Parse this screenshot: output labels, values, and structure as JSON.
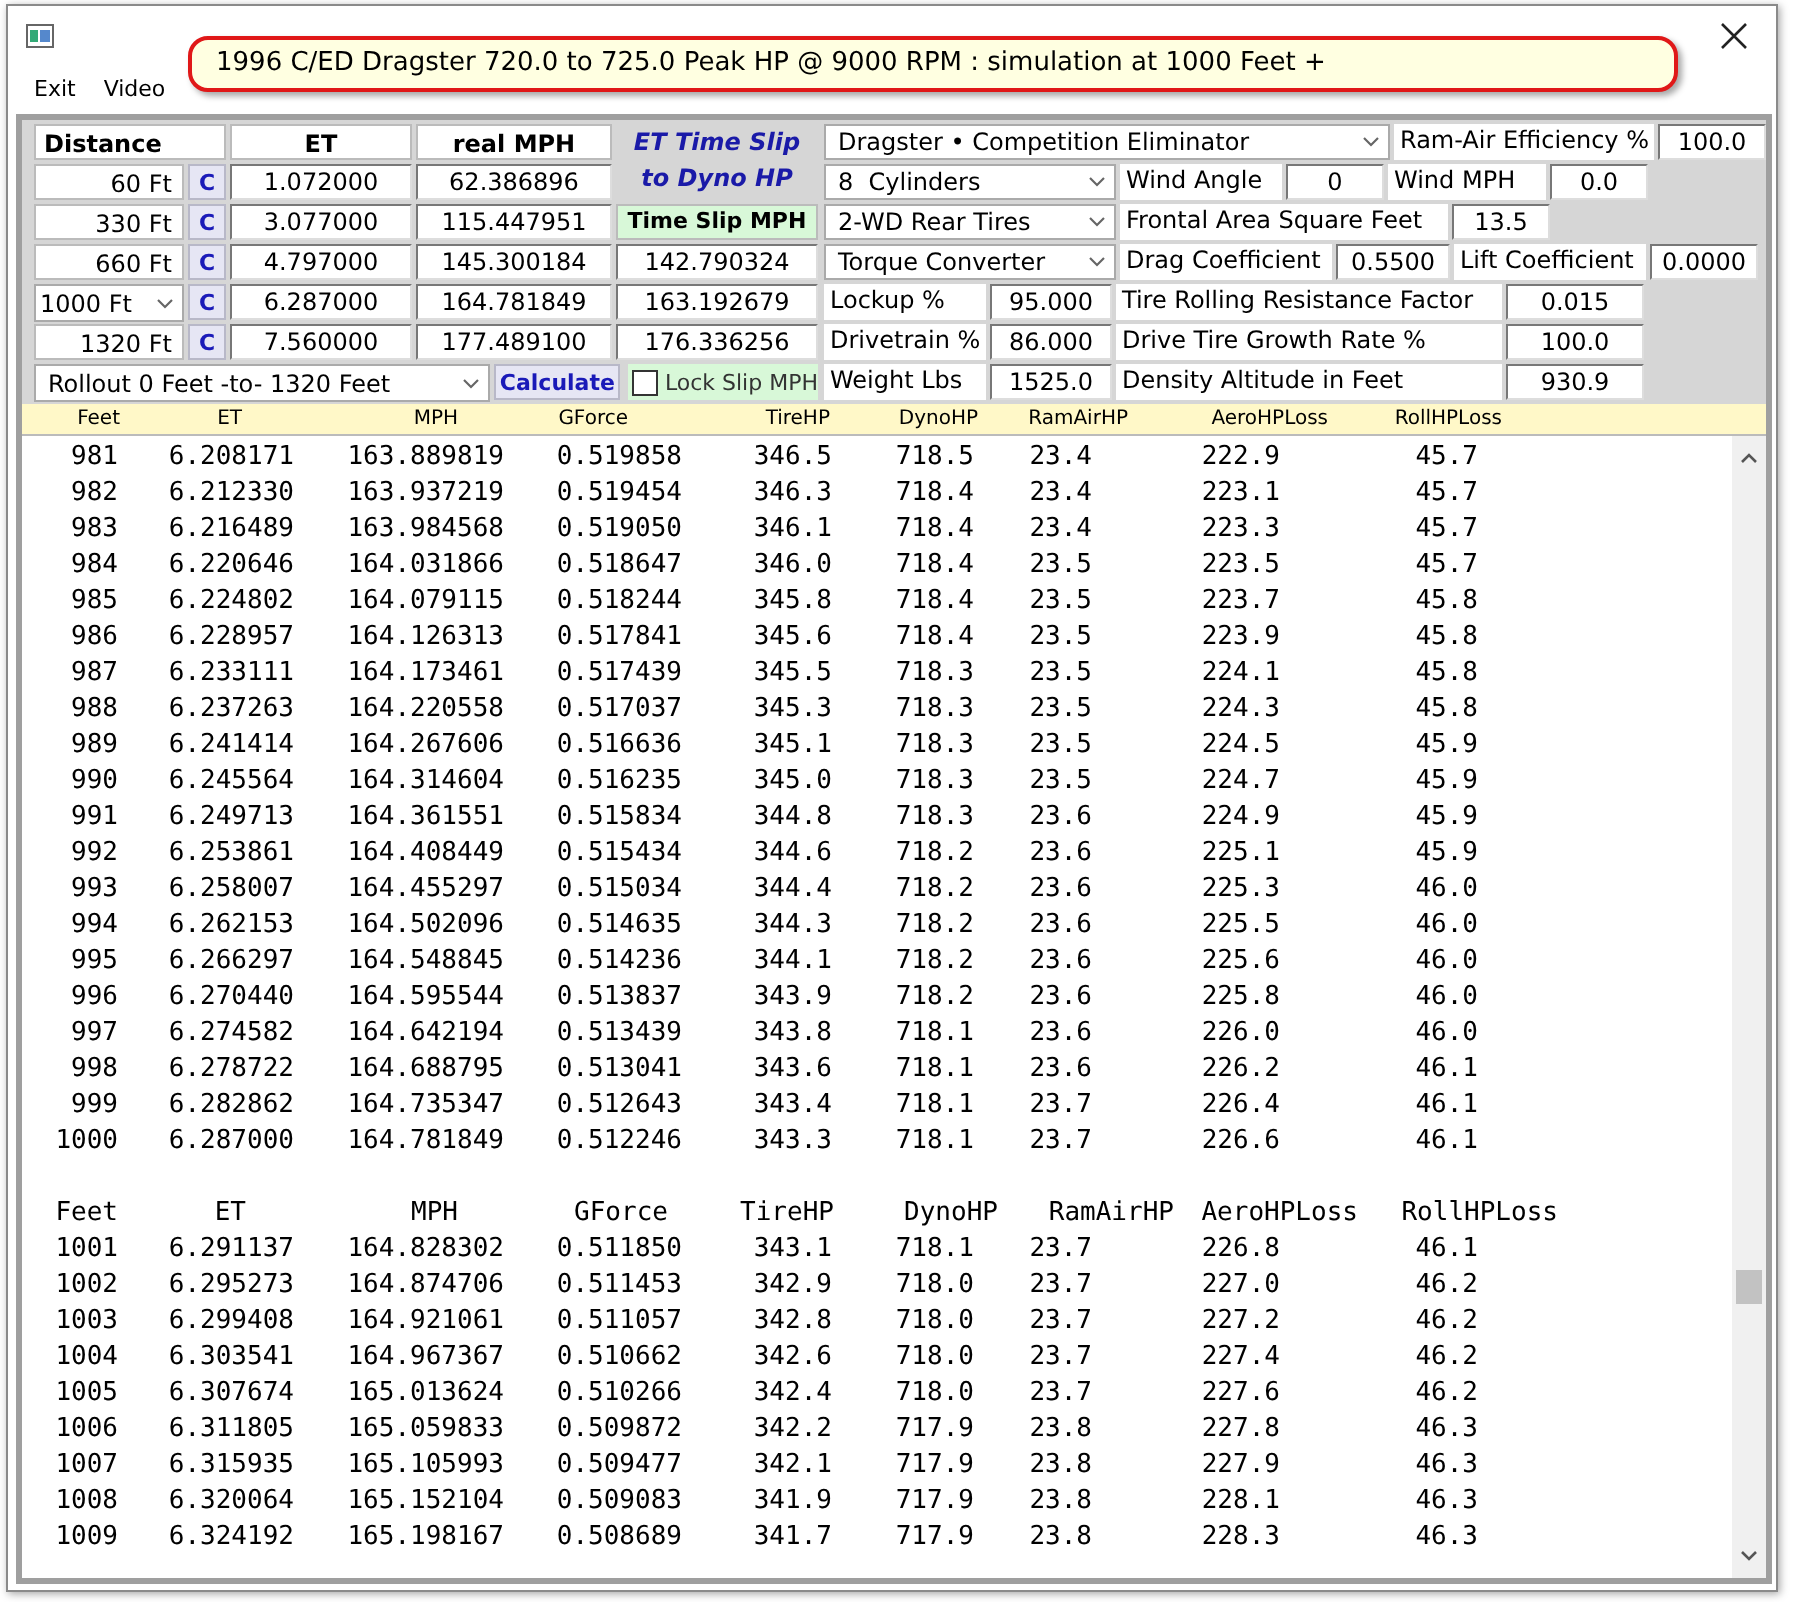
{
  "menu": [
    "Exit",
    "Video"
  ],
  "tooltip": "1996 C/ED Dragster 720.0 to 725.0 Peak HP @ 9000 RPM : simulation at 1000 Feet +",
  "distance_grid": {
    "columns": [
      "Distance",
      "ET",
      "real MPH"
    ],
    "rows": [
      {
        "distance": "60 Ft",
        "kind": "label",
        "button": "C",
        "et": "1.072000",
        "mph": "62.386896"
      },
      {
        "distance": "330 Ft",
        "kind": "label",
        "button": "C",
        "et": "3.077000",
        "mph": "115.447951"
      },
      {
        "distance": "660 Ft",
        "kind": "label",
        "button": "C",
        "et": "4.797000",
        "mph": "145.300184"
      },
      {
        "distance": "1000 Ft",
        "kind": "dropdown",
        "button": "C",
        "et": "6.287000",
        "mph": "164.781849"
      },
      {
        "distance": "1320 Ft",
        "kind": "label",
        "button": "C",
        "et": "7.560000",
        "mph": "177.489100"
      }
    ]
  },
  "time_slip": {
    "title": [
      "ET Time Slip",
      "to Dyno HP"
    ],
    "label": "Time Slip MPH",
    "values": [
      "142.790324",
      "163.192679",
      "176.336256"
    ]
  },
  "rollout": "Rollout 0 Feet -to- 1320 Feet",
  "calculate": "Calculate",
  "lock_slip": {
    "label": "Lock Slip MPH",
    "checked": false
  },
  "settings_rows": [
    {
      "items": [
        {
          "kind": "dropdown",
          "value": "Dragster • Competition Eliminator"
        },
        {
          "kind": "field",
          "label": "Ram-Air Efficiency %",
          "value": "100.0"
        }
      ]
    },
    {
      "items": [
        {
          "kind": "dropdown",
          "value": "8  Cylinders"
        },
        {
          "kind": "field",
          "label": "Wind Angle",
          "value": "0"
        },
        {
          "kind": "field",
          "label": "Wind MPH",
          "value": "0.0"
        }
      ]
    },
    {
      "items": [
        {
          "kind": "dropdown",
          "value": "2-WD Rear Tires"
        },
        {
          "kind": "field",
          "label": "Frontal Area Square Feet",
          "value": "13.5"
        }
      ]
    },
    {
      "items": [
        {
          "kind": "dropdown",
          "value": "Torque Converter"
        },
        {
          "kind": "field",
          "label": "Drag Coefficient",
          "value": "0.5500"
        },
        {
          "kind": "field",
          "label": "Lift Coefficient",
          "value": "0.0000"
        }
      ]
    },
    {
      "items": [
        {
          "kind": "field",
          "label": "Lockup %",
          "value": "95.000"
        },
        {
          "kind": "field",
          "label": "Tire Rolling Resistance Factor",
          "value": "0.015"
        }
      ]
    },
    {
      "items": [
        {
          "kind": "field",
          "label": "Drivetrain %",
          "value": "86.000"
        },
        {
          "kind": "field",
          "label": "Drive Tire Growth Rate %",
          "value": "100.0"
        }
      ]
    },
    {
      "items": [
        {
          "kind": "field",
          "label": "Weight Lbs",
          "value": "1525.0"
        },
        {
          "kind": "field",
          "label": "Density Altitude in Feet",
          "value": "930.9"
        }
      ]
    }
  ],
  "header_strip": [
    "Feet",
    "ET",
    "MPH",
    "GForce",
    "TireHP",
    "DynoHP",
    "RamAirHP",
    "AeroHPLoss",
    "RollHPLoss"
  ],
  "listing": [
    {
      "rows": [
        [
          "981",
          "6.208171",
          "163.889819",
          "0.519858",
          "346.5",
          "718.5",
          "23.4",
          "222.9",
          "45.7"
        ],
        [
          "982",
          "6.212330",
          "163.937219",
          "0.519454",
          "346.3",
          "718.4",
          "23.4",
          "223.1",
          "45.7"
        ],
        [
          "983",
          "6.216489",
          "163.984568",
          "0.519050",
          "346.1",
          "718.4",
          "23.4",
          "223.3",
          "45.7"
        ],
        [
          "984",
          "6.220646",
          "164.031866",
          "0.518647",
          "346.0",
          "718.4",
          "23.5",
          "223.5",
          "45.7"
        ],
        [
          "985",
          "6.224802",
          "164.079115",
          "0.518244",
          "345.8",
          "718.4",
          "23.5",
          "223.7",
          "45.8"
        ],
        [
          "986",
          "6.228957",
          "164.126313",
          "0.517841",
          "345.6",
          "718.4",
          "23.5",
          "223.9",
          "45.8"
        ],
        [
          "987",
          "6.233111",
          "164.173461",
          "0.517439",
          "345.5",
          "718.3",
          "23.5",
          "224.1",
          "45.8"
        ],
        [
          "988",
          "6.237263",
          "164.220558",
          "0.517037",
          "345.3",
          "718.3",
          "23.5",
          "224.3",
          "45.8"
        ],
        [
          "989",
          "6.241414",
          "164.267606",
          "0.516636",
          "345.1",
          "718.3",
          "23.5",
          "224.5",
          "45.9"
        ],
        [
          "990",
          "6.245564",
          "164.314604",
          "0.516235",
          "345.0",
          "718.3",
          "23.5",
          "224.7",
          "45.9"
        ],
        [
          "991",
          "6.249713",
          "164.361551",
          "0.515834",
          "344.8",
          "718.3",
          "23.6",
          "224.9",
          "45.9"
        ],
        [
          "992",
          "6.253861",
          "164.408449",
          "0.515434",
          "344.6",
          "718.2",
          "23.6",
          "225.1",
          "45.9"
        ],
        [
          "993",
          "6.258007",
          "164.455297",
          "0.515034",
          "344.4",
          "718.2",
          "23.6",
          "225.3",
          "46.0"
        ],
        [
          "994",
          "6.262153",
          "164.502096",
          "0.514635",
          "344.3",
          "718.2",
          "23.6",
          "225.5",
          "46.0"
        ],
        [
          "995",
          "6.266297",
          "164.548845",
          "0.514236",
          "344.1",
          "718.2",
          "23.6",
          "225.6",
          "46.0"
        ],
        [
          "996",
          "6.270440",
          "164.595544",
          "0.513837",
          "343.9",
          "718.2",
          "23.6",
          "225.8",
          "46.0"
        ],
        [
          "997",
          "6.274582",
          "164.642194",
          "0.513439",
          "343.8",
          "718.1",
          "23.6",
          "226.0",
          "46.0"
        ],
        [
          "998",
          "6.278722",
          "164.688795",
          "0.513041",
          "343.6",
          "718.1",
          "23.6",
          "226.2",
          "46.1"
        ],
        [
          "999",
          "6.282862",
          "164.735347",
          "0.512643",
          "343.4",
          "718.1",
          "23.7",
          "226.4",
          "46.1"
        ],
        [
          "1000",
          "6.287000",
          "164.781849",
          "0.512246",
          "343.3",
          "718.1",
          "23.7",
          "226.6",
          "46.1"
        ]
      ]
    },
    {
      "columns": [
        "Feet",
        "ET",
        "MPH",
        "GForce",
        "TireHP",
        "DynoHP",
        "RamAirHP",
        "AeroHPLoss",
        "RollHPLoss"
      ],
      "rows": [
        [
          "1001",
          "6.291137",
          "164.828302",
          "0.511850",
          "343.1",
          "718.1",
          "23.7",
          "226.8",
          "46.1"
        ],
        [
          "1002",
          "6.295273",
          "164.874706",
          "0.511453",
          "342.9",
          "718.0",
          "23.7",
          "227.0",
          "46.2"
        ],
        [
          "1003",
          "6.299408",
          "164.921061",
          "0.511057",
          "342.8",
          "718.0",
          "23.7",
          "227.2",
          "46.2"
        ],
        [
          "1004",
          "6.303541",
          "164.967367",
          "0.510662",
          "342.6",
          "718.0",
          "23.7",
          "227.4",
          "46.2"
        ],
        [
          "1005",
          "6.307674",
          "165.013624",
          "0.510266",
          "342.4",
          "718.0",
          "23.7",
          "227.6",
          "46.2"
        ],
        [
          "1006",
          "6.311805",
          "165.059833",
          "0.509872",
          "342.2",
          "717.9",
          "23.8",
          "227.8",
          "46.3"
        ],
        [
          "1007",
          "6.315935",
          "165.105993",
          "0.509477",
          "342.1",
          "717.9",
          "23.8",
          "227.9",
          "46.3"
        ],
        [
          "1008",
          "6.320064",
          "165.152104",
          "0.509083",
          "341.9",
          "717.9",
          "23.8",
          "228.1",
          "46.3"
        ],
        [
          "1009",
          "6.324192",
          "165.198167",
          "0.508689",
          "341.7",
          "717.9",
          "23.8",
          "228.3",
          "46.3"
        ]
      ]
    }
  ]
}
